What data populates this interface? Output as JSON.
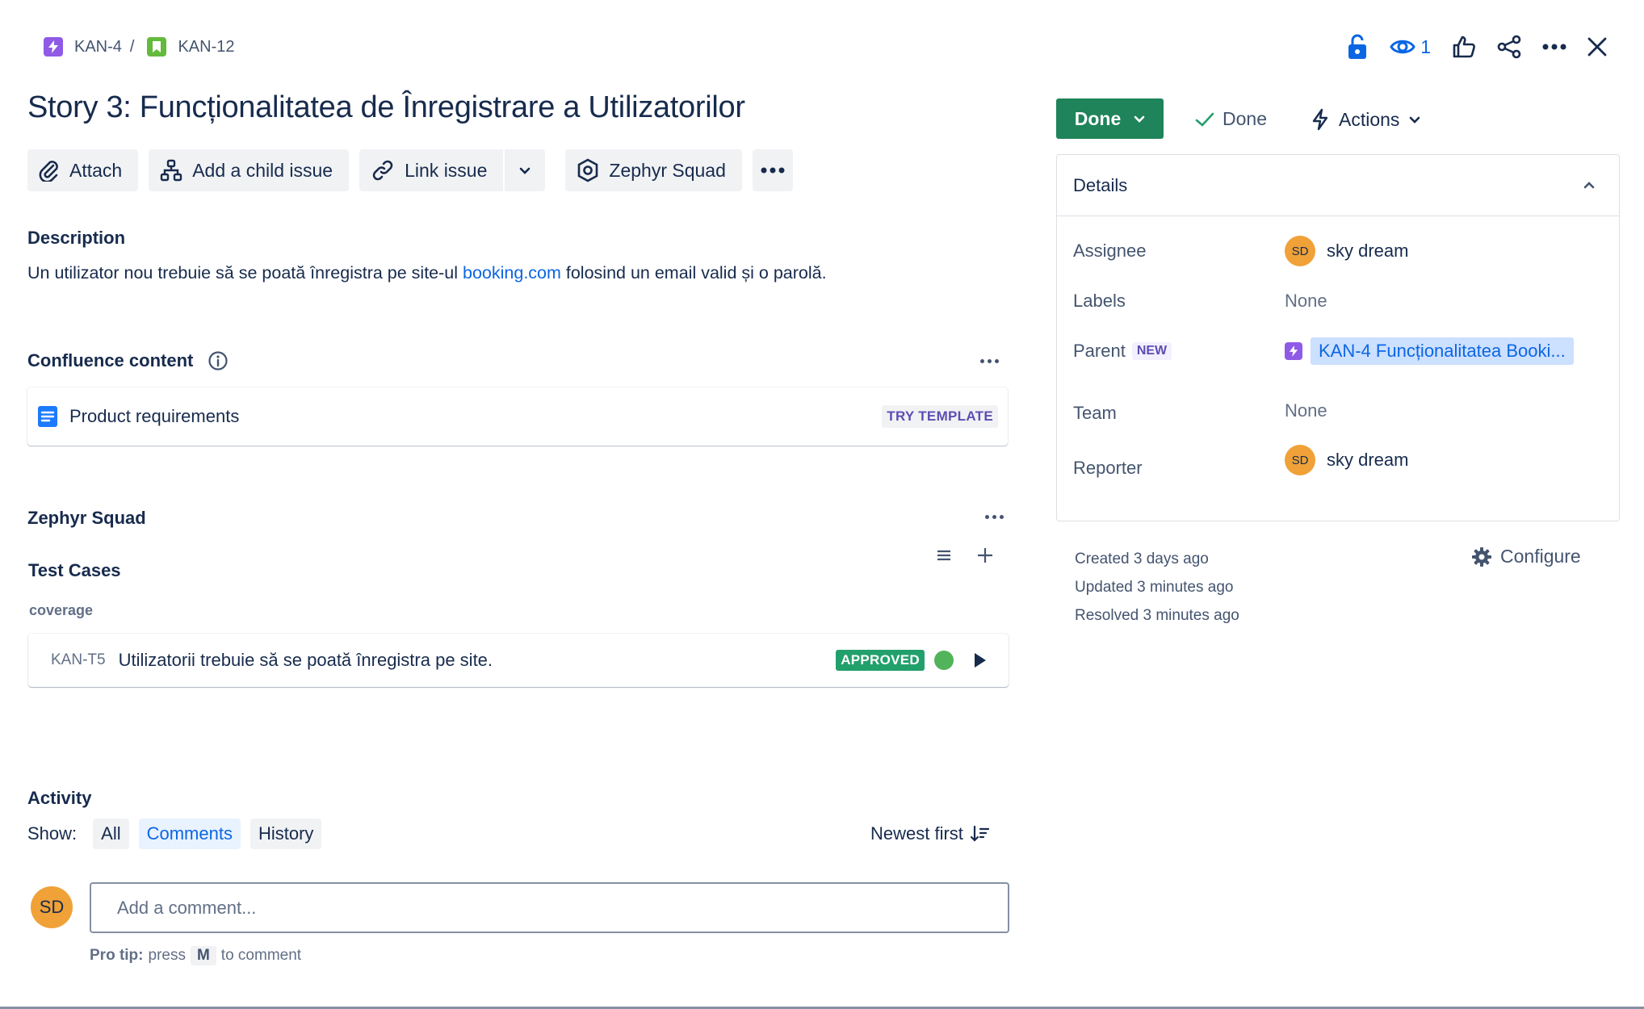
{
  "breadcrumb": {
    "parent_key": "KAN-4",
    "separator": "/",
    "issue_key": "KAN-12"
  },
  "header": {
    "watchers_count": "1"
  },
  "issue": {
    "title": "Story 3: Funcționalitatea de Înregistrare a Utilizatorilor"
  },
  "toolbar": {
    "attach": "Attach",
    "add_child": "Add a child issue",
    "link_issue": "Link issue",
    "zephyr": "Zephyr Squad"
  },
  "description": {
    "heading": "Description",
    "text_before": "Un utilizator nou trebuie să se poată înregistra pe site-ul ",
    "link": "booking.com",
    "text_after": " folosind un email valid și o parolă."
  },
  "confluence": {
    "heading": "Confluence content",
    "item": "Product requirements",
    "try_template": "TRY TEMPLATE"
  },
  "zephyr": {
    "heading": "Zephyr Squad",
    "test_cases_heading": "Test Cases",
    "coverage_label": "coverage",
    "test_case": {
      "key": "KAN-T5",
      "summary": "Utilizatorii trebuie să se poată înregistra pe site.",
      "status": "APPROVED"
    }
  },
  "activity": {
    "heading": "Activity",
    "show_label": "Show:",
    "filters": [
      "All",
      "Comments",
      "History"
    ],
    "active_filter": "Comments",
    "sort_label": "Newest first",
    "avatar_initials": "SD",
    "comment_placeholder": "Add a comment...",
    "pro_tip_label": "Pro tip:",
    "pro_tip_press": "press",
    "pro_tip_key": "M",
    "pro_tip_end": "to comment"
  },
  "status": {
    "button": "Done",
    "resolution": "Done",
    "actions": "Actions"
  },
  "details": {
    "heading": "Details",
    "assignee_label": "Assignee",
    "assignee_initials": "SD",
    "assignee_name": "sky dream",
    "labels_label": "Labels",
    "labels_value": "None",
    "parent_label": "Parent",
    "parent_badge": "NEW",
    "parent_value": "KAN-4 Funcționalitatea Booki...",
    "team_label": "Team",
    "team_value": "None",
    "reporter_label": "Reporter",
    "reporter_initials": "SD",
    "reporter_name": "sky dream"
  },
  "meta": {
    "created": "Created 3 days ago",
    "updated": "Updated 3 minutes ago",
    "resolved": "Resolved 3 minutes ago",
    "configure": "Configure"
  },
  "colors": {
    "done_green": "#1f845a",
    "link_blue": "#0c66e4",
    "epic_purple": "#8f5ae6",
    "story_green": "#63ba3c",
    "avatar_orange": "#f0a138"
  }
}
